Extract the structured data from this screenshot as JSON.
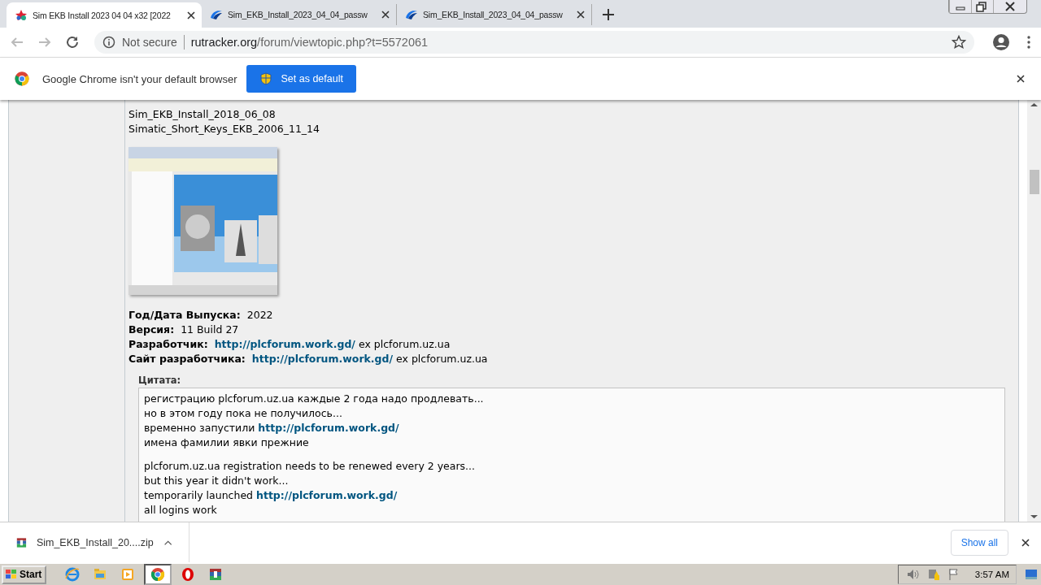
{
  "tabs": [
    {
      "title": "Sim EKB Install 2023 04 04 x32 [2022",
      "kind": "site",
      "selected": true
    },
    {
      "title": "Sim_EKB_Install_2023_04_04_passw",
      "kind": "swoosh",
      "selected": false
    },
    {
      "title": "Sim_EKB_Install_2023_04_04_passw",
      "kind": "swoosh",
      "selected": false
    }
  ],
  "address": {
    "security": "Not secure",
    "host": "rutracker.org",
    "path": "/forum/viewtopic.php?t=5572061"
  },
  "infobar": {
    "message": "Google Chrome isn't your default browser",
    "button": "Set as default"
  },
  "post": {
    "file_lines": [
      "Sim_EKB_Install_2018_06_08",
      "Simatic_Short_Keys_EKB_2006_11_14"
    ],
    "image": {
      "kind": "picture"
    },
    "fields": [
      {
        "label": "Год/Дата Выпуска:",
        "value": "2022"
      },
      {
        "label": "Версия:",
        "value": "11 Build 27"
      },
      {
        "label": "Разработчик:",
        "link": "http://plcforum.work.gd/",
        "value": "ex plcforum.uz.ua"
      },
      {
        "label": "Сайт разработчика:",
        "link": "http://plcforum.work.gd/",
        "value": "ex plcforum.uz.ua"
      }
    ],
    "quote": {
      "title": "Цитата:",
      "paragraphs": [
        [
          {
            "text": "регистрацию plcforum.uz.ua каждые 2 года надо продлевать..."
          },
          {
            "text": "но в этом году пока не получилось..."
          },
          {
            "text": "временно запустили",
            "link": "http://plcforum.work.gd/"
          },
          {
            "text": "имена фамилии явки прежние"
          }
        ],
        [
          {
            "text": "plcforum.uz.ua registration needs to be renewed every 2 years..."
          },
          {
            "text": "but this year it didn't work..."
          },
          {
            "text": "temporarily launched",
            "link": "http://plcforum.work.gd/"
          },
          {
            "text": "all logins work"
          }
        ]
      ]
    }
  },
  "download": {
    "file": "Sim_EKB_Install_20....zip",
    "show_all": "Show all"
  },
  "taskbar": {
    "start": "Start",
    "apps": [
      {
        "kind": "ie",
        "selected": false
      },
      {
        "kind": "folder",
        "selected": false
      },
      {
        "kind": "media",
        "selected": false
      },
      {
        "kind": "chrome",
        "selected": true
      },
      {
        "kind": "opera",
        "selected": false
      },
      {
        "kind": "winrar",
        "selected": false
      }
    ],
    "clock": "3:57 AM"
  }
}
